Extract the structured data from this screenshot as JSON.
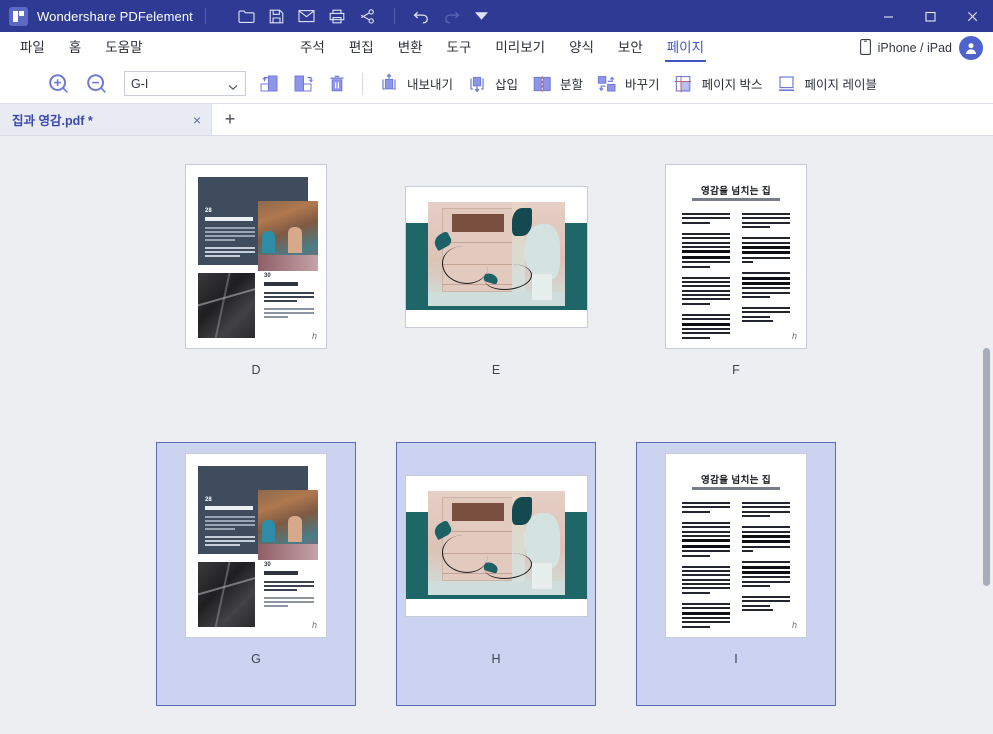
{
  "titlebar": {
    "app_title": "Wondershare PDFelement",
    "logo_icon": "pdfelement-logo-icon",
    "quick_actions": [
      {
        "name": "open-folder-icon",
        "label": "Open"
      },
      {
        "name": "save-icon",
        "label": "Save"
      },
      {
        "name": "email-icon",
        "label": "Email"
      },
      {
        "name": "print-icon",
        "label": "Print"
      },
      {
        "name": "share-icon",
        "label": "Share"
      }
    ],
    "history_actions": [
      {
        "name": "undo-icon",
        "label": "Undo",
        "enabled": true
      },
      {
        "name": "redo-icon",
        "label": "Redo",
        "enabled": false
      },
      {
        "name": "customize-toolbar-icon",
        "label": "Customize",
        "enabled": true
      }
    ],
    "window_controls": [
      {
        "name": "minimize-button",
        "glyph": "—"
      },
      {
        "name": "maximize-button",
        "glyph": "□"
      },
      {
        "name": "close-button",
        "glyph": "×"
      }
    ]
  },
  "menubar": {
    "left_items": [
      {
        "label": "파일"
      },
      {
        "label": "홈"
      },
      {
        "label": "도움말"
      }
    ],
    "mid_items": [
      {
        "label": "주석"
      },
      {
        "label": "편집"
      },
      {
        "label": "변환"
      },
      {
        "label": "도구"
      },
      {
        "label": "미리보기"
      },
      {
        "label": "양식"
      },
      {
        "label": "보안"
      },
      {
        "label": "페이지"
      }
    ],
    "active_item": "페이지",
    "device_label": "iPhone / iPad",
    "device_icon": "mobile-device-icon",
    "avatar_icon": "user-avatar-icon",
    "accent_color": "#4355c7"
  },
  "toolbar": {
    "zoom_in_label": "Zoom In",
    "zoom_out_label": "Zoom Out",
    "page_range_value": "G-I",
    "page_range_placeholder": "G-I",
    "buttons": [
      {
        "name": "move-page-up-button",
        "label": ""
      },
      {
        "name": "move-page-down-button",
        "label": ""
      },
      {
        "name": "delete-page-button",
        "label": ""
      }
    ],
    "actions": [
      {
        "name": "extract-button",
        "label": "내보내기",
        "icon": "extract-icon"
      },
      {
        "name": "insert-button",
        "label": "삽입",
        "icon": "insert-icon"
      },
      {
        "name": "split-button",
        "label": "분할",
        "icon": "split-icon"
      },
      {
        "name": "replace-button",
        "label": "바꾸기",
        "icon": "replace-icon"
      },
      {
        "name": "page-box-button",
        "label": "페이지 박스",
        "icon": "page-box-icon"
      },
      {
        "name": "page-label-button",
        "label": "페이지 레이블",
        "icon": "page-label-icon"
      }
    ]
  },
  "tabbar": {
    "document_name": "집과 영감.pdf *",
    "close_glyph": "×",
    "add_glyph": "+"
  },
  "pages": [
    {
      "label": "D",
      "type": "design",
      "selected": false,
      "orientation": "portrait",
      "page_numbers": [
        "28",
        "30"
      ],
      "watermark": "h"
    },
    {
      "label": "E",
      "type": "interior-photo",
      "selected": false,
      "orientation": "landscape",
      "band_color": "#1f6669",
      "watermark": ""
    },
    {
      "label": "F",
      "type": "text",
      "selected": false,
      "orientation": "portrait",
      "title": "영감을 넘치는 집",
      "watermark": "h"
    },
    {
      "label": "G",
      "type": "design",
      "selected": true,
      "orientation": "portrait",
      "page_numbers": [
        "28",
        "30"
      ],
      "watermark": "h"
    },
    {
      "label": "H",
      "type": "interior-photo",
      "selected": true,
      "orientation": "landscape",
      "band_color": "#1f6669",
      "watermark": ""
    },
    {
      "label": "I",
      "type": "text",
      "selected": true,
      "orientation": "portrait",
      "title": "영감을 넘치는 집",
      "watermark": "h"
    }
  ],
  "selection": {
    "border_color": "#5a6bb8",
    "fill_color": "#ccd3f0",
    "selected_labels": [
      "G",
      "H",
      "I"
    ]
  },
  "scrollbar": {
    "name": "vertical-scrollbar",
    "thumb_name": "vertical-scrollbar-thumb"
  },
  "colors": {
    "titlebar": "#2e3a94",
    "accent": "#4355c7",
    "content_bg": "#eceef1",
    "tool_icon": "#6f7bd8"
  }
}
